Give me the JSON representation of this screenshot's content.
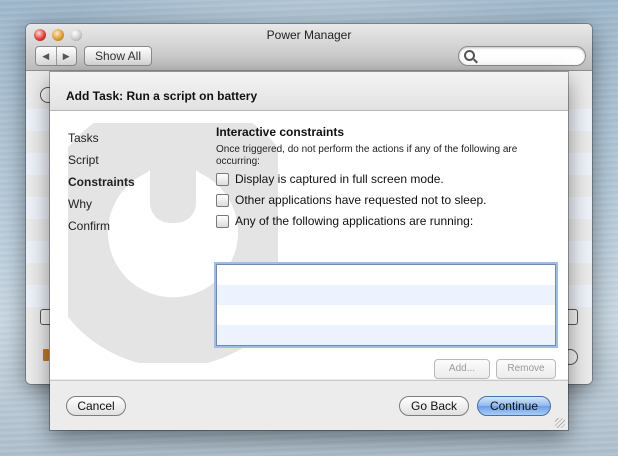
{
  "window": {
    "title": "Power Manager",
    "nav_back": "◀",
    "nav_forward": "▶",
    "show_all_label": "Show All",
    "search": {
      "placeholder": "",
      "value": ""
    }
  },
  "sheet": {
    "title": "Add Task: Run a script on battery",
    "steps": [
      {
        "label": "Tasks",
        "active": false
      },
      {
        "label": "Script",
        "active": false
      },
      {
        "label": "Constraints",
        "active": true
      },
      {
        "label": "Why",
        "active": false
      },
      {
        "label": "Confirm",
        "active": false
      }
    ],
    "panel": {
      "title": "Interactive constraints",
      "description": "Once triggered, do not perform the actions if any of the following are occurring:",
      "options": [
        {
          "label": "Display is captured in full screen mode.",
          "checked": false
        },
        {
          "label": "Other applications have requested not to sleep.",
          "checked": false
        },
        {
          "label": "Any of the following applications are running:",
          "checked": false
        }
      ],
      "app_list_items": [],
      "add_label": "Add...",
      "remove_label": "Remove"
    },
    "footer": {
      "cancel_label": "Cancel",
      "go_back_label": "Go Back",
      "continue_label": "Continue"
    }
  },
  "colors": {
    "default_button": "#7aa9ea",
    "focus_ring": "#9fbde6",
    "row_stripe": "#edf3fe"
  }
}
